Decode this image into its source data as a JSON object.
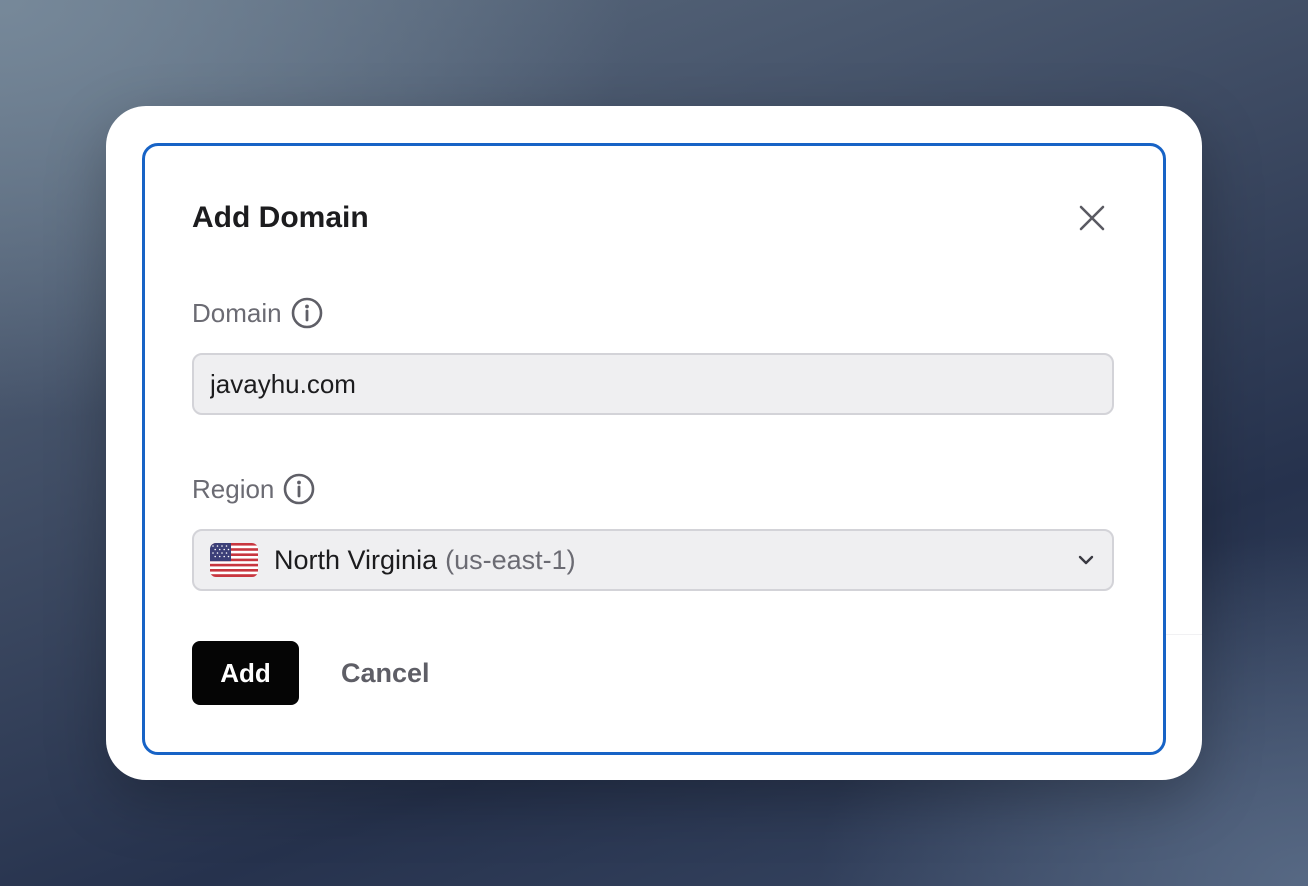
{
  "dialog": {
    "title": "Add Domain",
    "close_icon": "close-icon"
  },
  "domain_field": {
    "label": "Domain",
    "info_icon": "info-icon",
    "value": "javayhu.com"
  },
  "region_field": {
    "label": "Region",
    "info_icon": "info-icon",
    "flag_icon": "us-flag-icon",
    "selected_name": "North Virginia",
    "selected_code": "(us-east-1)",
    "chevron_icon": "chevron-down-icon"
  },
  "actions": {
    "add_label": "Add",
    "cancel_label": "Cancel"
  },
  "colors": {
    "accent_border": "#1763c6",
    "primary_button": "#050505",
    "input_background": "#efeff1"
  }
}
